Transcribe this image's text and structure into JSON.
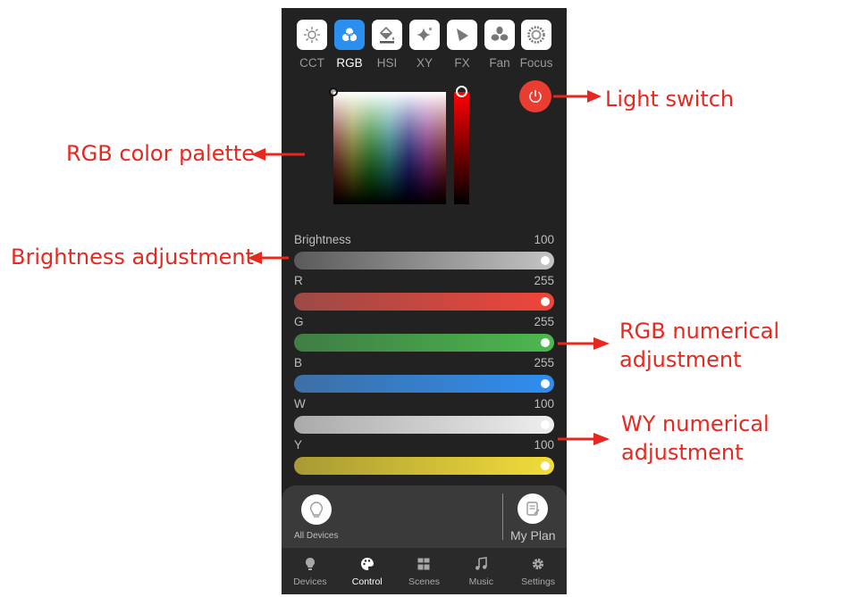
{
  "modes": [
    {
      "label": "CCT",
      "icon": "sun-icon",
      "active": false
    },
    {
      "label": "RGB",
      "icon": "color-circles-icon",
      "active": true
    },
    {
      "label": "HSI",
      "icon": "paint-bucket-icon",
      "active": false
    },
    {
      "label": "XY",
      "icon": "sparkle-icon",
      "active": false
    },
    {
      "label": "FX",
      "icon": "fx-flag-icon",
      "active": false
    },
    {
      "label": "Fan",
      "icon": "fan-icon",
      "active": false
    },
    {
      "label": "Focus",
      "icon": "focus-ring-icon",
      "active": false
    }
  ],
  "sliders": [
    {
      "label": "Brightness",
      "value": "100",
      "fraction": 1.0,
      "gradient": [
        "#5a5a5a",
        "#c4c4c4"
      ]
    },
    {
      "label": "R",
      "value": "255",
      "fraction": 1.0,
      "gradient": [
        "#9c4a46",
        "#f0453a"
      ]
    },
    {
      "label": "G",
      "value": "255",
      "fraction": 1.0,
      "gradient": [
        "#3f7d44",
        "#4cb84e"
      ]
    },
    {
      "label": "B",
      "value": "255",
      "fraction": 1.0,
      "gradient": [
        "#3d6fa6",
        "#2e8ef0"
      ]
    },
    {
      "label": "W",
      "value": "100",
      "fraction": 1.0,
      "gradient": [
        "#aaaaaa",
        "#eeeeee"
      ]
    },
    {
      "label": "Y",
      "value": "100",
      "fraction": 1.0,
      "gradient": [
        "#a89a34",
        "#f2dd3a"
      ]
    }
  ],
  "panel": {
    "all_devices": "All Devices",
    "my_plan": "My Plan"
  },
  "nav": [
    {
      "label": "Devices",
      "icon": "lightbulb-icon",
      "active": false
    },
    {
      "label": "Control",
      "icon": "palette-icon",
      "active": true
    },
    {
      "label": "Scenes",
      "icon": "grid-icon",
      "active": false
    },
    {
      "label": "Music",
      "icon": "music-note-icon",
      "active": false
    },
    {
      "label": "Settings",
      "icon": "gear-icon",
      "active": false
    }
  ],
  "annotations": {
    "light_switch": "Light switch",
    "rgb_palette": "RGB color palette",
    "brightness": "Brightness adjustment",
    "rgb_numeric_1": "RGB numerical",
    "rgb_numeric_2": "adjustment",
    "wy_numeric_1": "WY numerical",
    "wy_numeric_2": "adjustment"
  },
  "colors": {
    "accent": "#2b8ff0",
    "power": "#ea3c31",
    "annotation": "#e8271f",
    "panel_bg": "#222222"
  }
}
